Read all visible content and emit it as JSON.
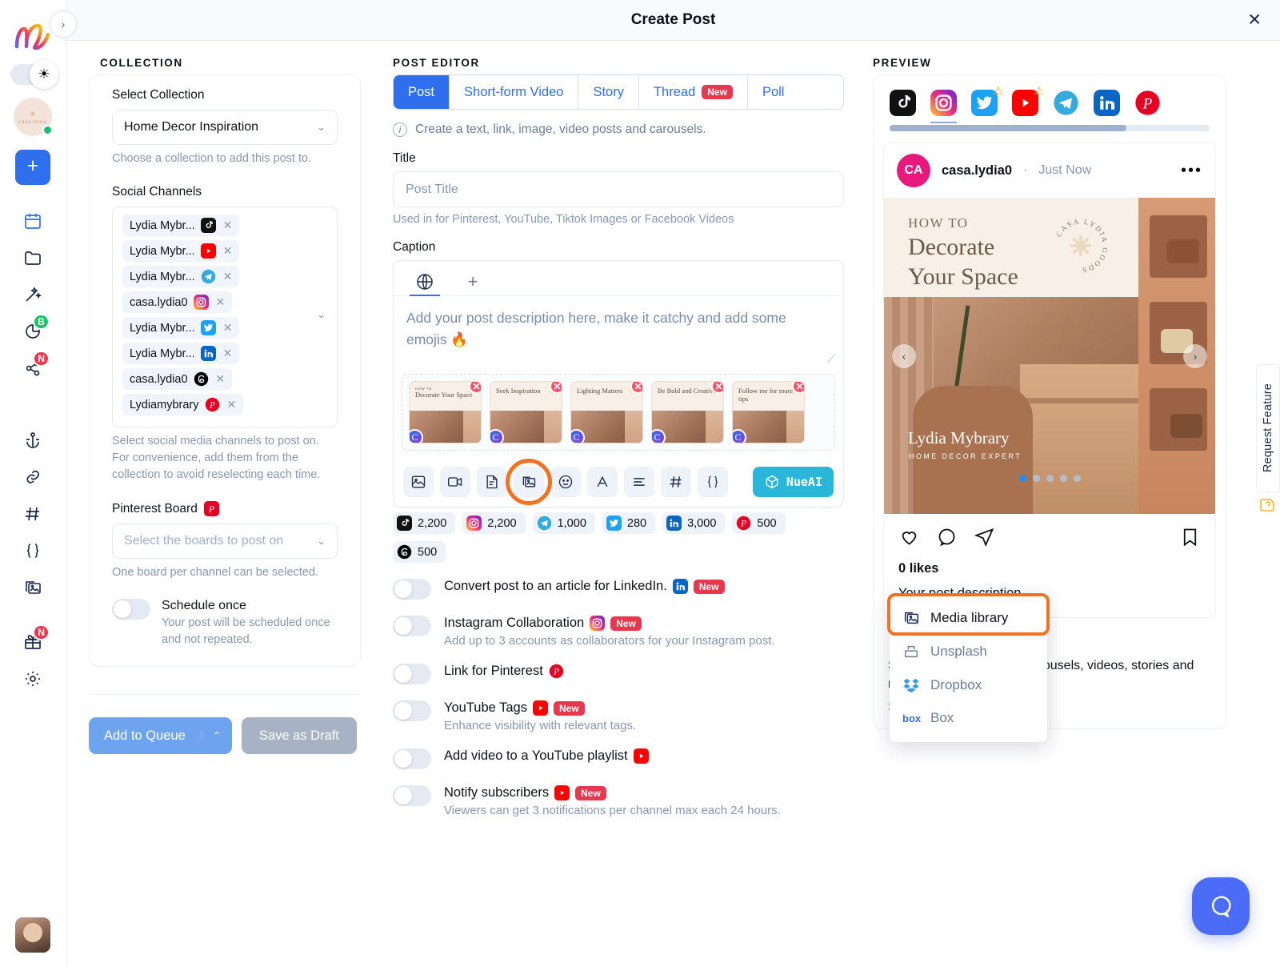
{
  "app": {
    "logo_alt": "nl-logo",
    "expand_label": "›",
    "plus_label": "+"
  },
  "rail": {
    "items": [
      {
        "name": "calendar",
        "badge": ""
      },
      {
        "name": "folder",
        "badge": ""
      },
      {
        "name": "magic-wand",
        "badge": ""
      },
      {
        "name": "analytics",
        "badge": "B"
      },
      {
        "name": "share",
        "badge": "N"
      },
      {
        "name": "anchor",
        "badge": ""
      },
      {
        "name": "link",
        "badge": ""
      },
      {
        "name": "hashtag",
        "badge": ""
      },
      {
        "name": "braces",
        "badge": ""
      },
      {
        "name": "media-folder",
        "badge": ""
      },
      {
        "name": "gift",
        "badge": "N"
      },
      {
        "name": "settings",
        "badge": ""
      }
    ]
  },
  "modal": {
    "title": "Create Post",
    "close_label": "✕"
  },
  "collection": {
    "heading": "COLLECTION",
    "select_collection_label": "Select Collection",
    "collection_value": "Home Decor Inspiration",
    "collection_hint": "Choose a collection to add this post to.",
    "social_channels_label": "Social Channels",
    "channels": [
      {
        "name": "Lydia Mybr...",
        "network": "tiktok"
      },
      {
        "name": "Lydia Mybr...",
        "network": "youtube"
      },
      {
        "name": "Lydia Mybr...",
        "network": "telegram"
      },
      {
        "name": "casa.lydia0",
        "network": "instagram"
      },
      {
        "name": "Lydia Mybr...",
        "network": "twitter"
      },
      {
        "name": "Lydia Mybr...",
        "network": "linkedin"
      },
      {
        "name": "casa.lydia0",
        "network": "threads"
      },
      {
        "name": "Lydiamybrary",
        "network": "pinterest"
      }
    ],
    "channels_hint_1": "Select social media channels to post on.",
    "channels_hint_2": "For convenience, add them from the collection to avoid reselecting each time.",
    "pinterest_board_label": "Pinterest Board",
    "pinterest_board_placeholder": "Select the boards to post on",
    "pinterest_board_hint": "One board per channel can be selected.",
    "schedule_once_title": "Schedule once",
    "schedule_once_sub": "Your post will be scheduled once and not repeated.",
    "add_to_queue": "Add to Queue",
    "queue_caret": "⌃",
    "save_as_draft": "Save as Draft"
  },
  "editor": {
    "heading": "POST EDITOR",
    "tabs": [
      {
        "label": "Post",
        "selected": true,
        "badge": ""
      },
      {
        "label": "Short-form Video",
        "selected": false,
        "badge": ""
      },
      {
        "label": "Story",
        "selected": false,
        "badge": ""
      },
      {
        "label": "Thread",
        "selected": false,
        "badge": "New"
      },
      {
        "label": "Poll",
        "selected": false,
        "badge": ""
      }
    ],
    "info_text": "Create a text, link, image, video posts and carousels.",
    "title_label": "Title",
    "title_placeholder": "Post Title",
    "title_hint": "Used in for Pinterest, YouTube, Tiktok Images or Facebook Videos",
    "caption_label": "Caption",
    "caption_placeholder": "Add your post description here, make it catchy and add some emojis 🔥",
    "globe_tab": "globe-icon",
    "add_tab": "+",
    "thumbnails": [
      {
        "eyebrow": "HOW TO",
        "title": "Decorate Your Space"
      },
      {
        "eyebrow": "",
        "title": "Seek Inspiration"
      },
      {
        "eyebrow": "",
        "title": "Lighting Matters"
      },
      {
        "eyebrow": "",
        "title": "Be Bold and Creative"
      },
      {
        "eyebrow": "",
        "title": "Follow me for more tips"
      }
    ],
    "tools": [
      {
        "name": "image-icon"
      },
      {
        "name": "video-icon"
      },
      {
        "name": "document-icon"
      },
      {
        "name": "media-library-icon"
      },
      {
        "name": "emoji-icon"
      },
      {
        "name": "font-icon"
      },
      {
        "name": "align-icon"
      },
      {
        "name": "hashtag-icon"
      },
      {
        "name": "variables-icon"
      }
    ],
    "nueai_label": "NueAI",
    "counts": [
      {
        "network": "tiktok",
        "value": "2,200"
      },
      {
        "network": "instagram",
        "value": "2,200"
      },
      {
        "network": "telegram",
        "value": "1,000"
      },
      {
        "network": "twitter",
        "value": "280"
      },
      {
        "network": "linkedin",
        "value": "3,000"
      },
      {
        "network": "pinterest",
        "value": "500"
      },
      {
        "network": "threads",
        "value": "500"
      }
    ],
    "media_dropdown": [
      {
        "label": "Media library",
        "icon": "media-library-icon",
        "highlighted": true
      },
      {
        "label": "Unsplash",
        "icon": "unsplash-icon",
        "highlighted": false
      },
      {
        "label": "Dropbox",
        "icon": "dropbox-icon",
        "highlighted": false
      },
      {
        "label": "Box",
        "icon": "box-icon",
        "highlighted": false
      }
    ],
    "options": [
      {
        "label": "Convert post to an article for LinkedIn.",
        "network": "linkedin",
        "badge": "New",
        "sub": ""
      },
      {
        "label": "Instagram Collaboration",
        "network": "instagram",
        "badge": "New",
        "sub": "Add up to 3 accounts as collaborators for your Instagram post."
      },
      {
        "label": "Link for Pinterest",
        "network": "pinterest",
        "badge": "",
        "sub": ""
      },
      {
        "label": "YouTube Tags",
        "network": "youtube",
        "badge": "New",
        "sub": "Enhance visibility with relevant tags."
      },
      {
        "label": "Add video to a YouTube playlist",
        "network": "youtube",
        "badge": "",
        "sub": ""
      },
      {
        "label": "Notify subscribers",
        "network": "youtube",
        "badge": "New",
        "sub": "Viewers can get 3 notifications per channel max each 24 hours."
      }
    ]
  },
  "preview": {
    "heading": "PREVIEW",
    "networks": [
      {
        "name": "tiktok",
        "warning": false,
        "selected": false
      },
      {
        "name": "instagram",
        "warning": false,
        "selected": true
      },
      {
        "name": "twitter",
        "warning": true,
        "selected": false
      },
      {
        "name": "youtube",
        "warning": true,
        "selected": false
      },
      {
        "name": "telegram",
        "warning": false,
        "selected": false
      },
      {
        "name": "linkedin",
        "warning": false,
        "selected": false
      },
      {
        "name": "pinterest",
        "warning": false,
        "selected": false
      }
    ],
    "avatar_initials": "CA",
    "username": "casa.lydia0",
    "separator": "·",
    "timestamp": "Just Now",
    "more_dots": "•••",
    "media": {
      "eyebrow": "HOW TO",
      "title_line1": "Decorate",
      "title_line2": "Your Space",
      "stamp_text": "CASA LYDIA GOODS",
      "overlay_name": "Lydia Mybrary",
      "overlay_sub": "HOME DECOR EXPERT",
      "slide_count": 5,
      "active_slide": 1,
      "prev_arrow": "‹",
      "next_arrow": "›"
    },
    "likes": "0 likes",
    "description": "Your post description.",
    "spec_icons": [
      "image-icon",
      "carousel-icon",
      "video-icon",
      "story-icon",
      "reels-icon"
    ],
    "spec_text": "Supports images posts, carousels, videos, stories and reels.",
    "spec_link": "See Specifications",
    "spec_link_caret": "⌄"
  },
  "feature_tab": {
    "label": "Request Feature"
  },
  "colors": {
    "accent_blue": "#2f6fed",
    "orange_highlight": "#f4721f",
    "new_badge_red": "#e8384f",
    "nueai_teal": "#29b6d8",
    "green_badge": "#17c964"
  }
}
